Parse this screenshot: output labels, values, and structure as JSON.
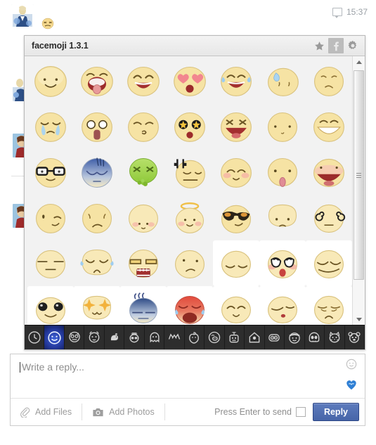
{
  "comment": {
    "avatar_name": "user-avatar",
    "posted_emoji": "grin-squint-emoji",
    "timestamp": "15:37",
    "bubble_icon": "comment-bubble-icon"
  },
  "popup": {
    "title": "facemoji 1.3.1",
    "buttons": [
      {
        "name": "favorite-star-button",
        "icon": "star-icon",
        "label": "★",
        "active": false
      },
      {
        "name": "facebook-info-button",
        "icon": "facebook-f-icon",
        "label": "f",
        "active": true
      },
      {
        "name": "settings-button",
        "icon": "gear-icon",
        "label": "⚙",
        "active": false
      }
    ],
    "scrollbar": {
      "up_arrow": "scroll-up-arrow",
      "down_arrow": "scroll-down-arrow",
      "thumb": "scroll-thumb"
    },
    "emoji_rows": [
      [
        {
          "name": "smile-emoji",
          "hovered": false
        },
        {
          "name": "tongue-out-open-mouth-emoji",
          "hovered": false
        },
        {
          "name": "happy-laugh-emoji",
          "hovered": false
        },
        {
          "name": "heart-eyes-emoji",
          "hovered": false
        },
        {
          "name": "joy-tears-emoji",
          "hovered": false
        },
        {
          "name": "cold-sweat-emoji",
          "hovered": false
        },
        {
          "name": "worried-emoji",
          "hovered": false
        }
      ],
      [
        {
          "name": "crying-emoji",
          "hovered": false
        },
        {
          "name": "shocked-wide-eyes-emoji",
          "hovered": false
        },
        {
          "name": "kiss-emoji",
          "hovered": false
        },
        {
          "name": "star-struck-emoji",
          "hovered": false
        },
        {
          "name": "laughing-loud-emoji",
          "hovered": false
        },
        {
          "name": "neutral-dots-emoji",
          "hovered": false
        },
        {
          "name": "big-grin-emoji",
          "hovered": false
        }
      ],
      [
        {
          "name": "nerd-glasses-emoji",
          "hovered": false
        },
        {
          "name": "gloomy-blue-emoji",
          "hovered": false
        },
        {
          "name": "sick-vomit-emoji",
          "hovered": false
        },
        {
          "name": "angry-vein-emoji",
          "hovered": false
        },
        {
          "name": "blush-smile-emoji",
          "hovered": false
        },
        {
          "name": "tongue-stick-emoji",
          "hovered": false
        },
        {
          "name": "shout-open-mouth-emoji",
          "hovered": false
        }
      ],
      [
        {
          "name": "wink-emoji",
          "hovered": false
        },
        {
          "name": "frown-emoji",
          "hovered": false
        },
        {
          "name": "shy-small-smile-emoji",
          "hovered": false
        },
        {
          "name": "angel-halo-emoji",
          "hovered": false
        },
        {
          "name": "sunglasses-cool-emoji",
          "hovered": false
        },
        {
          "name": "pout-emoji",
          "hovered": false
        },
        {
          "name": "dizzy-spiral-eyes-emoji",
          "hovered": false
        }
      ],
      [
        {
          "name": "blank-stare-emoji",
          "hovered": false
        },
        {
          "name": "distressed-tears-emoji",
          "hovered": false
        },
        {
          "name": "grimace-teeth-emoji",
          "hovered": false
        },
        {
          "name": "confused-emoji",
          "hovered": false
        },
        {
          "name": "sleepy-closed-eyes-emoji",
          "hovered": true
        },
        {
          "name": "teary-puppy-eyes-emoji",
          "hovered": true
        },
        {
          "name": "smug-squint-emoji",
          "hovered": true
        }
      ],
      [
        {
          "name": "big-black-eyes-emoji",
          "hovered": true
        },
        {
          "name": "sparkle-eyes-emoji",
          "hovered": true
        },
        {
          "name": "gloomy-steam-emoji",
          "hovered": true
        },
        {
          "name": "exhausted-red-emoji",
          "hovered": true
        },
        {
          "name": "content-smile-emoji",
          "hovered": true
        },
        {
          "name": "quiet-small-mouth-emoji",
          "hovered": true
        },
        {
          "name": "sad-worried-emoji",
          "hovered": true
        }
      ]
    ],
    "categories": [
      {
        "name": "category-recent",
        "icon": "clock-icon",
        "active": false
      },
      {
        "name": "category-smileys",
        "icon": "smiley-face-icon",
        "active": true
      },
      {
        "name": "category-monsters",
        "icon": "monster-face-icon",
        "active": false
      },
      {
        "name": "category-devil",
        "icon": "devil-face-icon",
        "active": false
      },
      {
        "name": "category-bird",
        "icon": "bird-icon",
        "active": false
      },
      {
        "name": "category-alien",
        "icon": "alien-icon",
        "active": false
      },
      {
        "name": "category-ghost",
        "icon": "ghost-icon",
        "active": false
      },
      {
        "name": "category-cat-ears",
        "icon": "cat-ears-icon",
        "active": false
      },
      {
        "name": "category-apple",
        "icon": "apple-icon",
        "active": false
      },
      {
        "name": "category-pig",
        "icon": "pig-icon",
        "active": false
      },
      {
        "name": "category-robot",
        "icon": "robot-icon",
        "active": false
      },
      {
        "name": "category-house",
        "icon": "house-icon",
        "active": false
      },
      {
        "name": "category-owl",
        "icon": "owl-icon",
        "active": false
      },
      {
        "name": "category-hat-face",
        "icon": "hat-face-icon",
        "active": false
      },
      {
        "name": "category-skull",
        "icon": "skull-icon",
        "active": false
      },
      {
        "name": "category-cat",
        "icon": "cat-icon",
        "active": false
      },
      {
        "name": "category-bear",
        "icon": "bear-icon",
        "active": false
      }
    ]
  },
  "composer": {
    "placeholder": "Write a reply...",
    "value": "",
    "emoji_button": "smiley-icon",
    "facemoji_button": "facemoji-heart-icon",
    "add_files_label": "Add Files",
    "add_files_icon": "paperclip-icon",
    "add_photos_label": "Add Photos",
    "add_photos_icon": "camera-icon",
    "enter_hint": "Press Enter to send",
    "enter_checked": false,
    "reply_label": "Reply"
  },
  "colors": {
    "reply_button": "#4765a8",
    "active_category": "#24399c",
    "toolbar_bg": "#2d2d2d",
    "panel_bg": "#f2f2f2"
  }
}
